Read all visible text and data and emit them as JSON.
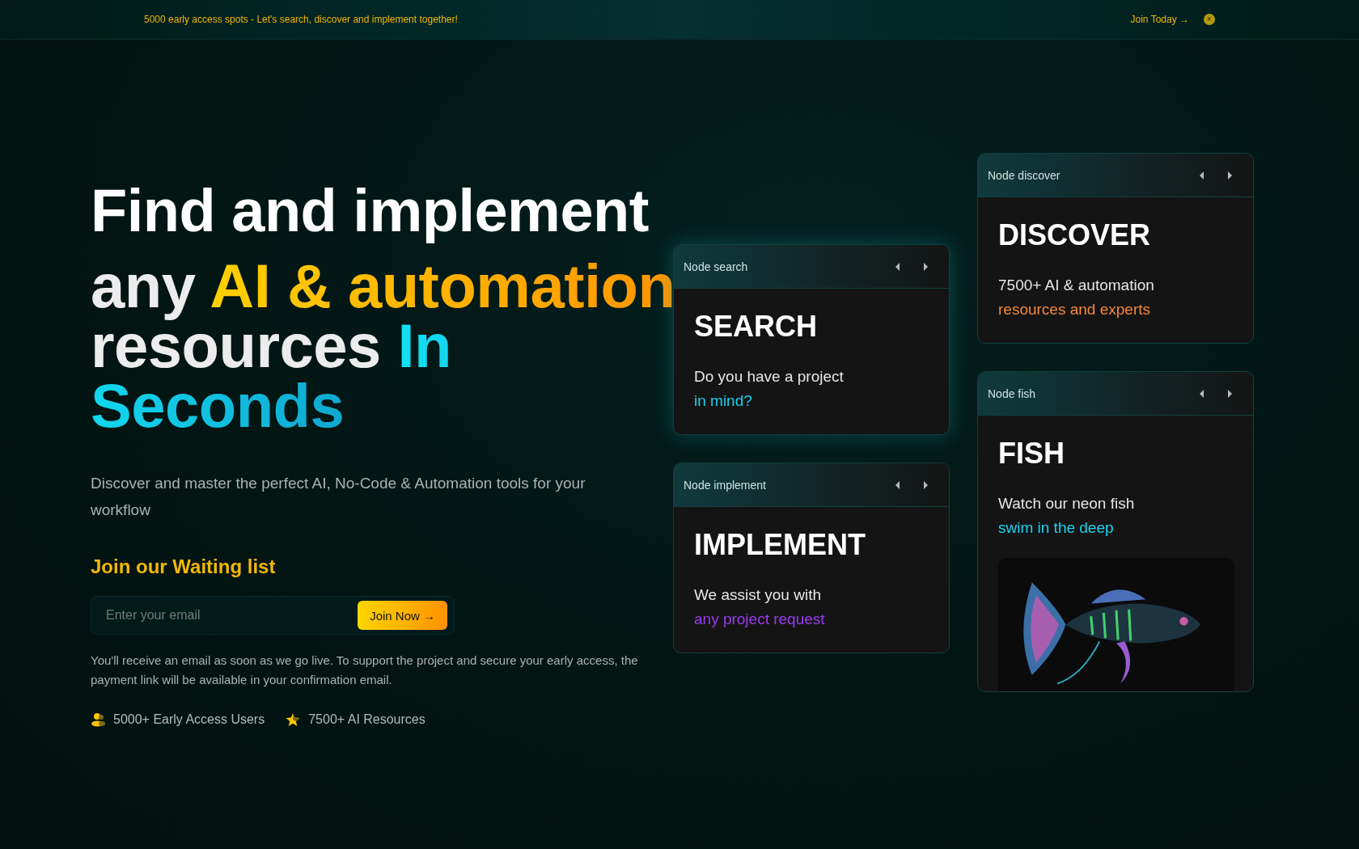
{
  "banner": {
    "text": "5000 early access spots - Let's search, discover and implement together!",
    "link": "Join Today →",
    "close": "×"
  },
  "headline": {
    "first_line": "Find and implement",
    "segments": [
      {
        "text": "any ",
        "kind": "plain"
      },
      {
        "text": "AI & automation",
        "kind": "gold"
      },
      {
        "text": " resources ",
        "kind": "plain"
      },
      {
        "text": "In Seconds",
        "kind": "cyan"
      }
    ]
  },
  "subtitle": "Discover and master the perfect AI, No-Code & Automation tools for your workflow",
  "waitlist": {
    "title": "Join our Waiting list",
    "placeholder": "Enter your email",
    "button": "Join Now →",
    "note": "You'll receive an email as soon as we go live. To support the project and secure your early access, the payment link will be available in your confirmation email."
  },
  "stats": [
    {
      "kind": "users",
      "text": "5000+ Early Access Users"
    },
    {
      "kind": "star",
      "text": "7500+ AI Resources"
    }
  ],
  "card_columns": [
    {
      "cards": [
        {
          "header": "Node search",
          "title": "SEARCH",
          "line": "Do you have a project",
          "accent": "in mind?",
          "color": "#19d3f0",
          "glow": true
        },
        {
          "header": "Node implement",
          "title": "IMPLEMENT",
          "line": "We assist you with",
          "accent": "any project request",
          "color": "#9a3cf0",
          "glow": false
        }
      ]
    },
    {
      "cards": [
        {
          "header": "Node discover",
          "title": "DISCOVER",
          "line": "7500+ AI & automation",
          "accent": "resources and experts",
          "color": "#f5893a",
          "glow": false
        },
        {
          "header": "Node fish",
          "title": "FISH",
          "line": "Watch our neon fish",
          "accent": "swim in the deep",
          "color": "#19d3f0",
          "glow": false
        }
      ]
    }
  ]
}
